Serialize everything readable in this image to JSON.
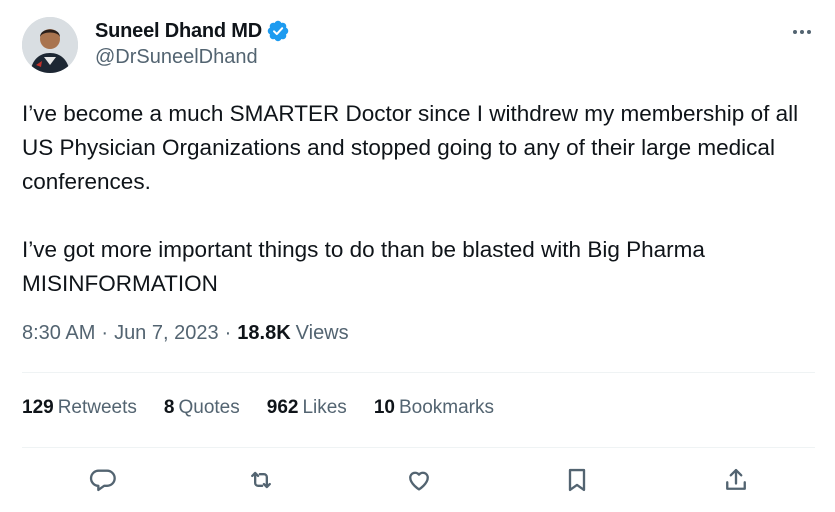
{
  "author": {
    "name": "Suneel Dhand MD",
    "handle": "@DrSuneelDhand",
    "verified_color": "#1d9bf0"
  },
  "tweet": {
    "text": "I’ve become a much SMARTER Doctor since I withdrew my membership of all US Physician Organizations and stopped going to any of their large medical conferences.\n\nI’ve got more important things to do than be blasted with Big Pharma MISINFORMATION"
  },
  "meta": {
    "time": "8:30 AM",
    "separator": "·",
    "date": "Jun 7, 2023",
    "views_count": "18.8K",
    "views_label": "Views"
  },
  "stats": {
    "retweets_count": "129",
    "retweets_label": "Retweets",
    "quotes_count": "8",
    "quotes_label": "Quotes",
    "likes_count": "962",
    "likes_label": "Likes",
    "bookmarks_count": "10",
    "bookmarks_label": "Bookmarks"
  },
  "actions": [
    "reply-icon",
    "retweet-icon",
    "like-icon",
    "bookmark-icon",
    "share-icon"
  ]
}
